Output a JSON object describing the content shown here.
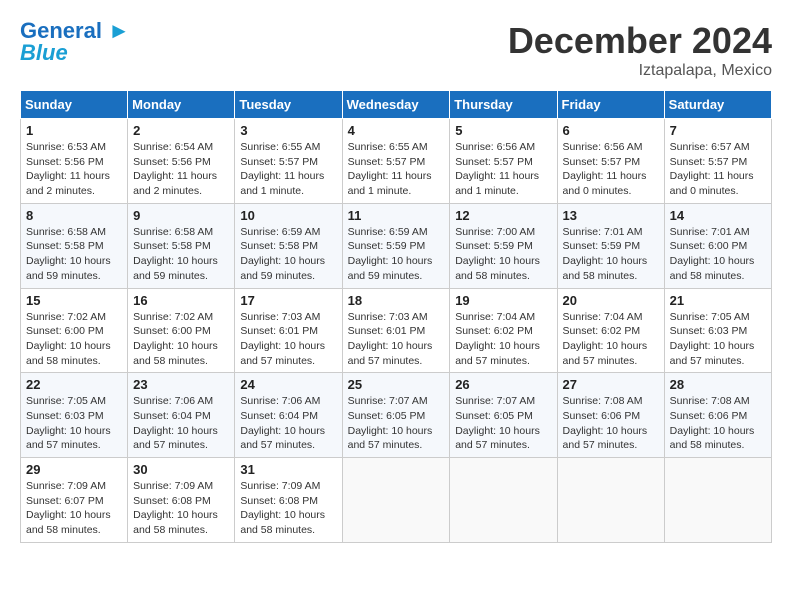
{
  "header": {
    "logo_line1": "General",
    "logo_line2": "Blue",
    "month_title": "December 2024",
    "location": "Iztapalapa, Mexico"
  },
  "weekdays": [
    "Sunday",
    "Monday",
    "Tuesday",
    "Wednesday",
    "Thursday",
    "Friday",
    "Saturday"
  ],
  "weeks": [
    [
      {
        "day": "1",
        "info": "Sunrise: 6:53 AM\nSunset: 5:56 PM\nDaylight: 11 hours and 2 minutes."
      },
      {
        "day": "2",
        "info": "Sunrise: 6:54 AM\nSunset: 5:56 PM\nDaylight: 11 hours and 2 minutes."
      },
      {
        "day": "3",
        "info": "Sunrise: 6:55 AM\nSunset: 5:57 PM\nDaylight: 11 hours and 1 minute."
      },
      {
        "day": "4",
        "info": "Sunrise: 6:55 AM\nSunset: 5:57 PM\nDaylight: 11 hours and 1 minute."
      },
      {
        "day": "5",
        "info": "Sunrise: 6:56 AM\nSunset: 5:57 PM\nDaylight: 11 hours and 1 minute."
      },
      {
        "day": "6",
        "info": "Sunrise: 6:56 AM\nSunset: 5:57 PM\nDaylight: 11 hours and 0 minutes."
      },
      {
        "day": "7",
        "info": "Sunrise: 6:57 AM\nSunset: 5:57 PM\nDaylight: 11 hours and 0 minutes."
      }
    ],
    [
      {
        "day": "8",
        "info": "Sunrise: 6:58 AM\nSunset: 5:58 PM\nDaylight: 10 hours and 59 minutes."
      },
      {
        "day": "9",
        "info": "Sunrise: 6:58 AM\nSunset: 5:58 PM\nDaylight: 10 hours and 59 minutes."
      },
      {
        "day": "10",
        "info": "Sunrise: 6:59 AM\nSunset: 5:58 PM\nDaylight: 10 hours and 59 minutes."
      },
      {
        "day": "11",
        "info": "Sunrise: 6:59 AM\nSunset: 5:59 PM\nDaylight: 10 hours and 59 minutes."
      },
      {
        "day": "12",
        "info": "Sunrise: 7:00 AM\nSunset: 5:59 PM\nDaylight: 10 hours and 58 minutes."
      },
      {
        "day": "13",
        "info": "Sunrise: 7:01 AM\nSunset: 5:59 PM\nDaylight: 10 hours and 58 minutes."
      },
      {
        "day": "14",
        "info": "Sunrise: 7:01 AM\nSunset: 6:00 PM\nDaylight: 10 hours and 58 minutes."
      }
    ],
    [
      {
        "day": "15",
        "info": "Sunrise: 7:02 AM\nSunset: 6:00 PM\nDaylight: 10 hours and 58 minutes."
      },
      {
        "day": "16",
        "info": "Sunrise: 7:02 AM\nSunset: 6:00 PM\nDaylight: 10 hours and 58 minutes."
      },
      {
        "day": "17",
        "info": "Sunrise: 7:03 AM\nSunset: 6:01 PM\nDaylight: 10 hours and 57 minutes."
      },
      {
        "day": "18",
        "info": "Sunrise: 7:03 AM\nSunset: 6:01 PM\nDaylight: 10 hours and 57 minutes."
      },
      {
        "day": "19",
        "info": "Sunrise: 7:04 AM\nSunset: 6:02 PM\nDaylight: 10 hours and 57 minutes."
      },
      {
        "day": "20",
        "info": "Sunrise: 7:04 AM\nSunset: 6:02 PM\nDaylight: 10 hours and 57 minutes."
      },
      {
        "day": "21",
        "info": "Sunrise: 7:05 AM\nSunset: 6:03 PM\nDaylight: 10 hours and 57 minutes."
      }
    ],
    [
      {
        "day": "22",
        "info": "Sunrise: 7:05 AM\nSunset: 6:03 PM\nDaylight: 10 hours and 57 minutes."
      },
      {
        "day": "23",
        "info": "Sunrise: 7:06 AM\nSunset: 6:04 PM\nDaylight: 10 hours and 57 minutes."
      },
      {
        "day": "24",
        "info": "Sunrise: 7:06 AM\nSunset: 6:04 PM\nDaylight: 10 hours and 57 minutes."
      },
      {
        "day": "25",
        "info": "Sunrise: 7:07 AM\nSunset: 6:05 PM\nDaylight: 10 hours and 57 minutes."
      },
      {
        "day": "26",
        "info": "Sunrise: 7:07 AM\nSunset: 6:05 PM\nDaylight: 10 hours and 57 minutes."
      },
      {
        "day": "27",
        "info": "Sunrise: 7:08 AM\nSunset: 6:06 PM\nDaylight: 10 hours and 57 minutes."
      },
      {
        "day": "28",
        "info": "Sunrise: 7:08 AM\nSunset: 6:06 PM\nDaylight: 10 hours and 58 minutes."
      }
    ],
    [
      {
        "day": "29",
        "info": "Sunrise: 7:09 AM\nSunset: 6:07 PM\nDaylight: 10 hours and 58 minutes."
      },
      {
        "day": "30",
        "info": "Sunrise: 7:09 AM\nSunset: 6:08 PM\nDaylight: 10 hours and 58 minutes."
      },
      {
        "day": "31",
        "info": "Sunrise: 7:09 AM\nSunset: 6:08 PM\nDaylight: 10 hours and 58 minutes."
      },
      null,
      null,
      null,
      null
    ]
  ]
}
